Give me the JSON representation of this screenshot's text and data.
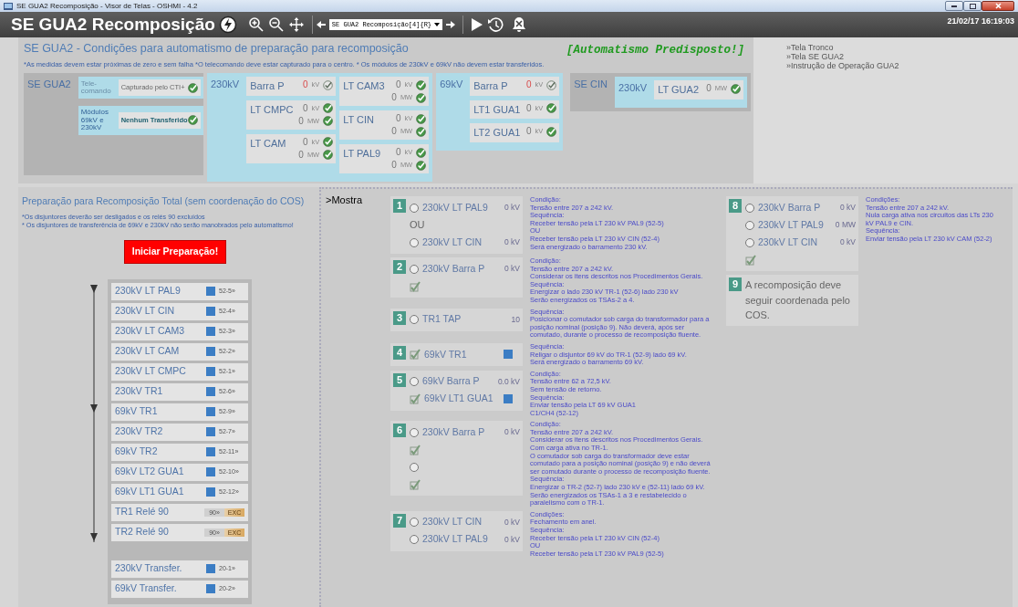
{
  "window": {
    "title": "SE GUA2 Recomposição - Visor de Telas - OSHMI - 4.2"
  },
  "header": {
    "title": "SE GUA2 Recomposição",
    "screen_select": "SE GUA2 Recomposição[4]{R}",
    "datetime": "21/02/17 16:19:03"
  },
  "conditions": {
    "title": "SE GUA2 - Condições para automatismo de preparação para recomposição",
    "note": "*As medidas devem estar próximas de zero e sem falha  *O telecomando deve estar capturado para o centro. * Os módulos de 230kV e 69kV não devem estar transferidos.",
    "status": "[Automatismo Predisposto!]",
    "groups": [
      {
        "kind": "commands",
        "label": "SE GUA2",
        "rows": [
          {
            "label": "Tele-comando",
            "value": "Capturado pelo CTI+",
            "dim": true,
            "ok": true
          },
          {
            "label": "Módulos 69kV e 230kV",
            "value": "Nenhum Transferido",
            "dim": false,
            "ok": true
          }
        ]
      },
      {
        "kind": "bus",
        "label": "230kV",
        "columns": [
          [
            {
              "name": "Barra P",
              "readings": [
                {
                  "value": "0",
                  "unit": "kV",
                  "ok": false
                }
              ]
            },
            {
              "name": "LT CMPC",
              "readings": [
                {
                  "value": "0",
                  "unit": "kV",
                  "ok": true
                },
                {
                  "value": "0",
                  "unit": "MW",
                  "ok": true
                }
              ]
            },
            {
              "name": "LT CAM",
              "readings": [
                {
                  "value": "0",
                  "unit": "kV",
                  "ok": true
                },
                {
                  "value": "0",
                  "unit": "MW",
                  "ok": true
                }
              ]
            }
          ],
          [
            {
              "name": "LT CAM3",
              "readings": [
                {
                  "value": "0",
                  "unit": "kV",
                  "ok": true
                },
                {
                  "value": "0",
                  "unit": "MW",
                  "ok": true
                }
              ]
            },
            {
              "name": "LT CIN",
              "readings": [
                {
                  "value": "0",
                  "unit": "kV",
                  "ok": true
                },
                {
                  "value": "0",
                  "unit": "MW",
                  "ok": true
                }
              ]
            },
            {
              "name": "LT PAL9",
              "readings": [
                {
                  "value": "0",
                  "unit": "kV",
                  "ok": true
                },
                {
                  "value": "0",
                  "unit": "MW",
                  "ok": true
                }
              ]
            }
          ]
        ]
      },
      {
        "kind": "bus",
        "label": "69kV",
        "columns": [
          [
            {
              "name": "Barra P",
              "readings": [
                {
                  "value": "0",
                  "unit": "kV",
                  "ok": false
                }
              ]
            },
            {
              "name": "LT1 GUA1",
              "readings": [
                {
                  "value": "0",
                  "unit": "kV",
                  "ok": true
                }
              ]
            },
            {
              "name": "LT2 GUA1",
              "readings": [
                {
                  "value": "0",
                  "unit": "kV",
                  "ok": true
                }
              ]
            }
          ]
        ]
      },
      {
        "kind": "station",
        "label": "SE CIN",
        "bus": {
          "label": "230kV",
          "columns": [
            [
              {
                "name": "LT GUA2",
                "readings": [
                  {
                    "value": "0",
                    "unit": "MW",
                    "ok": true
                  }
                ]
              }
            ]
          ]
        }
      }
    ]
  },
  "links": [
    "»Tela Tronco",
    "»Tela SE GUA2",
    "»Instrução de Operação GUA2"
  ],
  "preparation": {
    "title": "Preparação para Recomposição Total (sem coordenação do COS)",
    "notes": [
      "*Os disjuntores deverão ser desligados e os relés 90 excluídos",
      "* Os disjuntores de transferência de 69kV e 230kV não serão manobrados pelo automatismo!"
    ],
    "button": "Iniciar Preparação!",
    "sequence": [
      {
        "kind": "breaker",
        "name": "230kV LT PAL9",
        "code": "52-5»"
      },
      {
        "kind": "breaker",
        "name": "230kV LT CIN",
        "code": "52-4»"
      },
      {
        "kind": "breaker",
        "name": "230kV LT CAM3",
        "code": "52-3»"
      },
      {
        "kind": "breaker",
        "name": "230kV LT CAM",
        "code": "52-2»"
      },
      {
        "kind": "breaker",
        "name": "230kV LT CMPC",
        "code": "52-1»"
      },
      {
        "kind": "breaker",
        "name": "230kV TR1",
        "code": "52-6»"
      },
      {
        "kind": "breaker",
        "name": "69kV TR1",
        "code": "52-9»"
      },
      {
        "kind": "breaker",
        "name": "230kV TR2",
        "code": "52-7»"
      },
      {
        "kind": "breaker",
        "name": "69kV TR2",
        "code": "52-11»"
      },
      {
        "kind": "breaker",
        "name": "69kV LT2 GUA1",
        "code": "52-10»"
      },
      {
        "kind": "breaker",
        "name": "69kV LT1 GUA1",
        "code": "52-12»"
      },
      {
        "kind": "relay",
        "name": "TR1 Relé 90",
        "code": "90»",
        "state": "EXC"
      },
      {
        "kind": "relay",
        "name": "TR2 Relé 90",
        "code": "90»",
        "state": "EXC"
      }
    ],
    "transfer": [
      {
        "kind": "breaker",
        "name": "230kV Transfer.",
        "code": "20-1»"
      },
      {
        "kind": "breaker",
        "name": "69kV Transfer.",
        "code": "20-2»"
      }
    ]
  },
  "steps_panel": {
    "link": ">Mostra",
    "columns": [
      [
        {
          "number": "1",
          "rows": [
            {
              "kind": "radio",
              "label": "230kV LT PAL9",
              "value": "0 kV",
              "selected": false
            },
            {
              "kind": "text",
              "label": "OU"
            },
            {
              "kind": "radio",
              "label": "230kV LT CIN",
              "value": "0 kV",
              "selected": false
            }
          ],
          "notes": [
            "Condição:",
            "Tensão entre 207 a 242 kV.",
            "Sequência:",
            "Receber tensão pela LT 230 kV PAL9 (52-5)",
            "OU",
            "Receber tensão pela LT 230 kV CIN (52-4)",
            "Será energizado o barramento 230 kV."
          ]
        },
        {
          "number": "2",
          "rows": [
            {
              "kind": "radio",
              "label": "230kV Barra P",
              "value": "0 kV",
              "selected": false
            },
            {
              "kind": "check",
              "checked": true
            }
          ],
          "notes": [
            "Condição:",
            "Tensão entre 207 a 242 kV.",
            "Considerar os itens descritos nos Procedimentos Gerais.",
            "Sequência:",
            "Energizar o lado 230 kV TR-1 (52-6) lado 230 kV",
            "Serão energizados os TSAs-2 a 4."
          ]
        },
        {
          "number": "3",
          "rows": [
            {
              "kind": "radio",
              "label": "TR1 TAP",
              "value": "10",
              "selected": false
            }
          ],
          "notes": [
            "Sequência:",
            "Posicionar o comutador sob carga do transformador para a posição nominal (posição 9). Não deverá, após ser comutado, durante o processo de recomposição fluente."
          ]
        },
        {
          "number": "4",
          "rows": [
            {
              "kind": "check",
              "label": "69kV TR1",
              "checked": true,
              "breaker": true
            }
          ],
          "notes": [
            "Sequência:",
            "Religar o disjuntor 69 kV do TR-1 (52-9) lado 69 kV.",
            "Será energizado o barramento 69 kV."
          ]
        },
        {
          "number": "5",
          "rows": [
            {
              "kind": "radio",
              "label": "69kV Barra P",
              "value": "0.0 kV",
              "selected": false
            },
            {
              "kind": "check",
              "label": "69kV LT1 GUA1",
              "checked": true,
              "breaker": true
            }
          ],
          "notes": [
            "Condição:",
            "Tensão entre 62 a 72,5 kV.",
            "Sem tensão de retorno.",
            "Sequência:",
            "Enviar tensão pela LT 69 kV GUA1",
            "C1/CH4 (52-12)"
          ]
        },
        {
          "number": "6",
          "rows": [
            {
              "kind": "radio",
              "label": "230kV Barra P",
              "value": "0 kV",
              "selected": false
            },
            {
              "kind": "check",
              "checked": true
            },
            {
              "kind": "radio",
              "selected": false
            },
            {
              "kind": "check",
              "checked": true
            }
          ],
          "notes": [
            "Condição:",
            "Tensão entre 207 a 242 kV.",
            "Considerar os itens descritos nos Procedimentos Gerais.",
            "Com carga ativa no TR-1.",
            "O comutador sob carga do transformador deve estar comutado para a posição nominal (posição 9) e não deverá ser comutado durante o processo de recomposição fluente.",
            "Sequência:",
            "Energizar o TR-2 (52-7) lado 230 kV e (52-11) lado 69 kV.",
            "Serão energizados os TSAs-1 a 3 e restabelecido o paralelismo com o TR-1."
          ]
        },
        {
          "number": "7",
          "rows": [
            {
              "kind": "radio",
              "label": "230kV LT CIN",
              "value": "0 kV",
              "selected": false
            },
            {
              "kind": "radio",
              "label": "230kV LT PAL9",
              "value": "0 kV",
              "selected": false
            }
          ],
          "notes": [
            "Condições:",
            "Fechamento em anel.",
            "Sequência:",
            "Receber tensão pela LT 230 kV CIN (52-4)",
            "OU",
            "Receber tensão pela LT 230 kV PAL9 (52-5)"
          ]
        }
      ],
      [
        {
          "number": "8",
          "rows": [
            {
              "kind": "radio",
              "label": "230kV Barra P",
              "value": "0 kV",
              "selected": false
            },
            {
              "kind": "radio",
              "label": "230kV LT PAL9",
              "value": "0 MW",
              "selected": false
            },
            {
              "kind": "radio",
              "label": "230kV LT CIN",
              "value": "0 kV",
              "selected": false
            },
            {
              "kind": "check",
              "checked": true
            }
          ],
          "notes": [
            "Condições:",
            "Tensão entre 207 a 242 kV.",
            "Nula carga ativa nos circuitos das LTs 230 kV PAL9 e CIN.",
            "Sequência:",
            "Enviar tensão pela LT 230 kV CAM (52-2)"
          ]
        },
        {
          "number": "9",
          "rows": [
            {
              "kind": "text",
              "label": "A recomposição deve seguir coordenada pelo COS."
            }
          ]
        }
      ]
    ]
  }
}
